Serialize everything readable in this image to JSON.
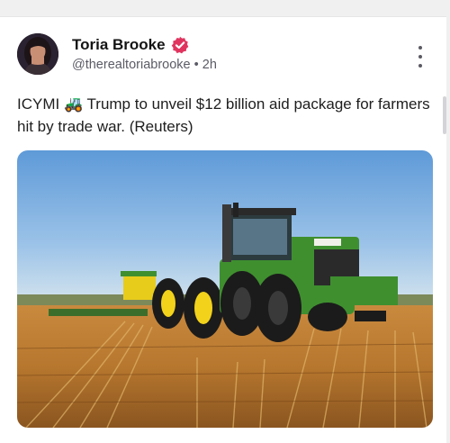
{
  "post": {
    "author_name": "Toria Brooke",
    "handle": "@therealtoriabrooke",
    "time": "2h",
    "text": "ICYMI 🚜 Trump to unveil $12 billion aid package for farmers hit by trade war. (Reuters)"
  },
  "media": {
    "icon": "tractor-in-wheat-field-photo"
  },
  "colors": {
    "verified_badge": "#e0345f",
    "tractor_green": "#3f8f2f",
    "tractor_yellow": "#f2d21a",
    "sky": "#7fb3e6"
  },
  "icons": {
    "more": "vertical-ellipsis-icon",
    "verified": "verified-badge-icon"
  }
}
